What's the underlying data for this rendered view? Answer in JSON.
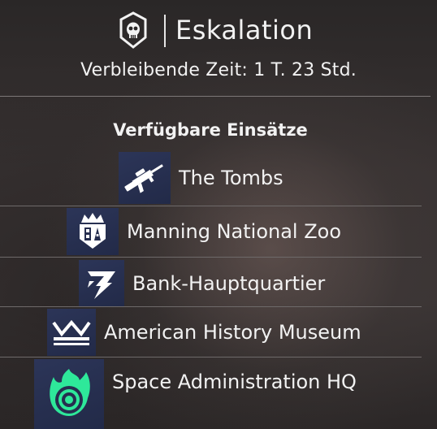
{
  "header": {
    "title": "Eskalation",
    "timer": "Verbleibende Zeit: 1 T. 23 Std.",
    "logo_icon": "skull-shield-icon"
  },
  "section": {
    "title": "Verfügbare Einsätze"
  },
  "missions": [
    {
      "label": "The Tombs",
      "icon": "rifle-icon"
    },
    {
      "label": "Manning National Zoo",
      "icon": "crowned-shield-icon"
    },
    {
      "label": "Bank-Hauptquartier",
      "icon": "lightning-emblem-icon"
    },
    {
      "label": "American History Museum",
      "icon": "crown-icon"
    },
    {
      "label": "Space Administration HQ",
      "icon": "green-flame-target-icon"
    }
  ],
  "colors": {
    "icon_bg": "#262e4f",
    "accent_green": "#2ee89a",
    "text": "#f2f2f2"
  }
}
